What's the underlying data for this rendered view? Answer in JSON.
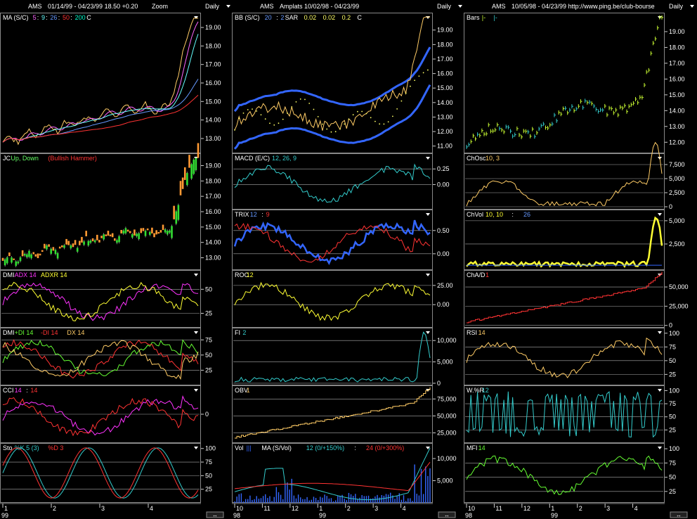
{
  "columns": [
    {
      "title_left": "AMS",
      "title_mid": "01/14/99 - 04/23/99   18.50  +0.20",
      "title_right": "Zoom",
      "period": "Daily",
      "x_labels": [
        "1",
        "2",
        "3",
        "4"
      ],
      "x_year": "99",
      "panes": [
        {
          "id": "ma",
          "legend": [
            {
              "t": "MA (S/C)",
              "c": "#ffffff"
            },
            {
              "t": "5",
              "c": "#ff66ff"
            },
            {
              "t": ":",
              "c": "#ffffff"
            },
            {
              "t": "9",
              "c": "#66ffff"
            },
            {
              "t": ":",
              "c": "#ffffff"
            },
            {
              "t": "26",
              "c": "#6699ff"
            },
            {
              "t": ":",
              "c": "#ffffff"
            },
            {
              "t": "50",
              "c": "#ff3333"
            },
            {
              "t": ":",
              "c": "#ffffff"
            },
            {
              "t": "200",
              "c": "#00ffcc"
            },
            {
              "t": "  C",
              "c": "#ffffff"
            }
          ],
          "ticks": [
            "19.00",
            "18.00",
            "17.00",
            "16.00",
            "15.00",
            "14.00",
            "13.00"
          ],
          "ylim": [
            12.2,
            19.8
          ]
        },
        {
          "id": "jc",
          "legend": [
            {
              "t": "JC",
              "c": "#ffffff"
            },
            {
              "t": " Up, Down ",
              "c": "#66ff66"
            },
            {
              "t": "(Bullish Hammer)",
              "c": "#ff3333"
            }
          ],
          "ticks": [
            "19.00",
            "18.00",
            "17.00",
            "16.00",
            "15.00",
            "14.00",
            "13.00"
          ],
          "ylim": [
            12.2,
            19.8
          ]
        },
        {
          "id": "dmi1",
          "legend": [
            {
              "t": "DMI",
              "c": "#ffffff"
            },
            {
              "t": " ADX 14",
              "c": "#ff33ff"
            },
            {
              "t": " ADXR 14",
              "c": "#ffff33"
            }
          ],
          "ticks": [
            "50",
            "25"
          ],
          "ylim": [
            10,
            70
          ]
        },
        {
          "id": "dmi2",
          "legend": [
            {
              "t": "DMI",
              "c": "#ffffff"
            },
            {
              "t": " +DI 14",
              "c": "#66ff33"
            },
            {
              "t": " -DI 14",
              "c": "#ff3333"
            },
            {
              "t": " DX 14",
              "c": "#ffcc66"
            }
          ],
          "ticks": [
            "75",
            "50",
            "25"
          ],
          "ylim": [
            0,
            95
          ]
        },
        {
          "id": "cci",
          "legend": [
            {
              "t": "CCI",
              "c": "#ffffff"
            },
            {
              "t": " 14",
              "c": "#ff33ff"
            },
            {
              "t": ":",
              "c": "#ffffff"
            },
            {
              "t": "14",
              "c": "#ff3333"
            }
          ],
          "ticks": [
            "0"
          ],
          "ylim": [
            -220,
            220
          ]
        },
        {
          "id": "sto",
          "legend": [
            {
              "t": "Sto",
              "c": "#ffffff"
            },
            {
              "t": " %K 5 (3)",
              "c": "#33cccc"
            },
            {
              "t": " %D 3",
              "c": "#ff3333"
            }
          ],
          "ticks": [
            "100",
            "75",
            "50",
            "25"
          ],
          "ylim": [
            0,
            110
          ]
        }
      ]
    },
    {
      "title_left": "AMS",
      "title_mid": "Amplats   10/02/98 - 04/23/99",
      "title_right": "",
      "period": "Daily",
      "x_labels": [
        "10",
        "11",
        "12",
        "1",
        "2",
        "3",
        "4"
      ],
      "x_year": "98",
      "x_year2": "99",
      "panes": [
        {
          "id": "bb",
          "legend": [
            {
              "t": "BB (S/C)",
              "c": "#ffffff"
            },
            {
              "t": " 20",
              "c": "#6699ff"
            },
            {
              "t": ":",
              "c": "#ffffff"
            },
            {
              "t": "2",
              "c": "#6699ff"
            },
            {
              "t": "  SAR",
              "c": "#ffffff"
            },
            {
              "t": " 0.02",
              "c": "#ffff66"
            },
            {
              "t": " 0.02",
              "c": "#ffff66"
            },
            {
              "t": " 0.2",
              "c": "#ffff66"
            },
            {
              "t": "  C",
              "c": "#ffffff"
            }
          ],
          "ticks": [
            "19.00",
            "18.00",
            "17.00",
            "16.00",
            "15.00",
            "14.00",
            "13.00",
            "12.00",
            "11.00"
          ],
          "ylim": [
            10.5,
            20.2
          ]
        },
        {
          "id": "macd",
          "legend": [
            {
              "t": "MACD (E/C)",
              "c": "#ffffff"
            },
            {
              "t": " 12, 26, 9",
              "c": "#33cccc"
            }
          ],
          "ticks": [
            "0.25",
            "0.00"
          ],
          "ylim": [
            -0.4,
            0.5
          ]
        },
        {
          "id": "trix",
          "legend": [
            {
              "t": "TRIX",
              "c": "#ffffff"
            },
            {
              "t": " 12",
              "c": "#6699ff"
            },
            {
              "t": ":",
              "c": "#ffffff"
            },
            {
              "t": "9",
              "c": "#ff3333"
            }
          ],
          "ticks": [
            "0.50",
            "0.00"
          ],
          "ylim": [
            -0.35,
            0.95
          ]
        },
        {
          "id": "roc",
          "legend": [
            {
              "t": "ROC",
              "c": "#ffffff"
            },
            {
              "t": " 12",
              "c": "#ffff33"
            }
          ],
          "ticks": [
            "25.00",
            "0.00"
          ],
          "ylim": [
            -30,
            45
          ]
        },
        {
          "id": "fi",
          "legend": [
            {
              "t": "FI",
              "c": "#ffffff"
            },
            {
              "t": " 2",
              "c": "#33cccc"
            }
          ],
          "ticks": [
            "10,000",
            "5,000",
            "0"
          ],
          "ylim": [
            -500,
            13000
          ]
        },
        {
          "id": "obv",
          "legend": [
            {
              "t": "OBV",
              "c": "#ffffff"
            },
            {
              "t": " 1",
              "c": "#ffcc66"
            }
          ],
          "ticks": [
            "75,000",
            "50,000",
            "25,000"
          ],
          "ylim": [
            10000,
            95000
          ]
        },
        {
          "id": "vol",
          "legend": [
            {
              "t": "Vol",
              "c": "#ffffff"
            },
            {
              "t": " |||",
              "c": "#3366ff"
            },
            {
              "t": "  MA (S/Vol)",
              "c": "#ffffff"
            },
            {
              "t": " 12 (0/+150%)",
              "c": "#33cccc"
            },
            {
              "t": " : ",
              "c": "#ffffff"
            },
            {
              "t": "24 (0/+300%)",
              "c": "#ff3333"
            }
          ],
          "ticks": [
            "10,000",
            "5,000"
          ],
          "ylim": [
            0,
            13500
          ]
        }
      ]
    },
    {
      "title_left": "AMS",
      "title_mid": "10/05/98 - 04/23/99   http://www.ping.be/club-bourse",
      "title_right": "",
      "period": "Daily",
      "x_labels": [
        "10",
        "11",
        "12",
        "1",
        "2",
        "3",
        "4"
      ],
      "x_year": "98",
      "x_year2": "99",
      "panes": [
        {
          "id": "bars",
          "legend": [
            {
              "t": "Bars",
              "c": "#ffffff"
            },
            {
              "t": " |-",
              "c": "#ccff33"
            },
            {
              "t": " |-",
              "c": "#33cccc"
            }
          ],
          "ticks": [
            "19.00",
            "18.00",
            "17.00",
            "16.00",
            "15.00",
            "14.00",
            "13.00",
            "12.00"
          ],
          "ylim": [
            11.3,
            20.2
          ]
        },
        {
          "id": "chosc",
          "legend": [
            {
              "t": "ChOsc",
              "c": "#ffffff"
            },
            {
              "t": " 10, 3",
              "c": "#ffcc66"
            }
          ],
          "ticks": [
            "7,500",
            "5,000",
            "2,500",
            "0"
          ],
          "ylim": [
            -500,
            9500
          ]
        },
        {
          "id": "chvol",
          "legend": [
            {
              "t": "ChVol",
              "c": "#ffffff"
            },
            {
              "t": " 10, 10",
              "c": "#ffff33"
            },
            {
              "t": " : ",
              "c": "#ffffff"
            },
            {
              "t": "26",
              "c": "#6699ff"
            }
          ],
          "ticks": [
            "5,000",
            "2,500"
          ],
          "ylim": [
            -300,
            6200
          ]
        },
        {
          "id": "chad",
          "legend": [
            {
              "t": "ChA/D",
              "c": "#ffffff"
            },
            {
              "t": " 1",
              "c": "#ff3333"
            }
          ],
          "ticks": [
            "50,000",
            "25,000",
            "0"
          ],
          "ylim": [
            -3000,
            72000
          ]
        },
        {
          "id": "rsi",
          "legend": [
            {
              "t": "RSI",
              "c": "#ffffff"
            },
            {
              "t": " 14",
              "c": "#ffcc66"
            }
          ],
          "ticks": [
            "100",
            "75",
            "50",
            "25"
          ],
          "ylim": [
            5,
            110
          ]
        },
        {
          "id": "wr",
          "legend": [
            {
              "t": "W.%R",
              "c": "#ffffff"
            },
            {
              "t": " 12",
              "c": "#33cccc"
            }
          ],
          "ticks": [
            "100",
            "75",
            "50",
            "25"
          ],
          "ylim": [
            0,
            110
          ]
        },
        {
          "id": "mfi",
          "legend": [
            {
              "t": "MFI",
              "c": "#ffffff"
            },
            {
              "t": " 14",
              "c": "#66ff33"
            }
          ],
          "ticks": [
            "100",
            "75",
            "50",
            "25"
          ],
          "ylim": [
            5,
            110
          ]
        }
      ]
    }
  ],
  "colors": {
    "grid": "#888888",
    "bg": "#000000",
    "text": "#ffffff"
  },
  "chart_data": [
    {
      "type": "line",
      "title": "MA (S/C) 5:9:26:50:200",
      "panel": "AMS 01/14/99 - 04/23/99",
      "x": "daily",
      "series": [
        {
          "name": "5",
          "color": "#ff66ff"
        },
        {
          "name": "9",
          "color": "#66ffff"
        },
        {
          "name": "26",
          "color": "#6699ff"
        },
        {
          "name": "50",
          "color": "#ff3333"
        },
        {
          "name": "C",
          "color": "#ffcc66"
        }
      ],
      "ylim": [
        12.2,
        19.8
      ]
    },
    {
      "type": "bar",
      "title": "JC Up, Down (Bullish Hammer)",
      "ylim": [
        12.2,
        19.8
      ]
    },
    {
      "type": "line",
      "title": "BB (S/C) 20:2 SAR 0.02 0.02 0.2",
      "ylim": [
        10.5,
        20.2
      ]
    },
    {
      "type": "line",
      "title": "MACD (E/C) 12, 26, 9",
      "ylim": [
        -0.4,
        0.5
      ]
    },
    {
      "type": "line",
      "title": "TRIX 12:9",
      "ylim": [
        -0.35,
        0.95
      ]
    },
    {
      "type": "line",
      "title": "ROC 12",
      "ylim": [
        -30,
        45
      ]
    },
    {
      "type": "line",
      "title": "FI 2",
      "ylim": [
        -500,
        13000
      ]
    },
    {
      "type": "line",
      "title": "OBV 1",
      "ylim": [
        10000,
        95000
      ]
    },
    {
      "type": "bar",
      "title": "Vol MA (S/Vol) 12 : 24",
      "ylim": [
        0,
        13500
      ]
    },
    {
      "type": "bar",
      "title": "Bars",
      "ylim": [
        11.3,
        20.2
      ]
    },
    {
      "type": "line",
      "title": "ChOsc 10, 3",
      "ylim": [
        -500,
        9500
      ]
    },
    {
      "type": "line",
      "title": "ChVol 10, 10 : 26",
      "ylim": [
        -300,
        6200
      ]
    },
    {
      "type": "line",
      "title": "ChA/D 1",
      "ylim": [
        -3000,
        72000
      ]
    },
    {
      "type": "line",
      "title": "RSI 14",
      "ylim": [
        5,
        110
      ]
    },
    {
      "type": "line",
      "title": "W.%R 12",
      "ylim": [
        0,
        110
      ]
    },
    {
      "type": "line",
      "title": "MFI 14",
      "ylim": [
        5,
        110
      ]
    },
    {
      "type": "line",
      "title": "DMI ADX 14 ADXR 14",
      "ylim": [
        10,
        70
      ]
    },
    {
      "type": "line",
      "title": "DMI +DI 14 -DI 14 DX 14",
      "ylim": [
        0,
        95
      ]
    },
    {
      "type": "line",
      "title": "CCI 14:14",
      "ylim": [
        -220,
        220
      ]
    },
    {
      "type": "line",
      "title": "Sto %K 5 (3) %D 3",
      "ylim": [
        0,
        110
      ]
    }
  ]
}
